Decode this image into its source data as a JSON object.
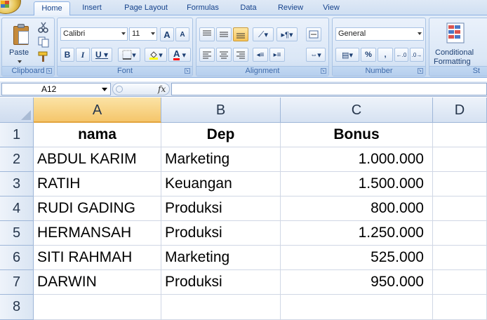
{
  "ribbon": {
    "tabs": [
      "Home",
      "Insert",
      "Page Layout",
      "Formulas",
      "Data",
      "Review",
      "View"
    ],
    "active_tab": "Home",
    "groups": {
      "clipboard": {
        "label": "Clipboard",
        "paste_label": "Paste"
      },
      "font": {
        "label": "Font",
        "font_name": "Calibri",
        "font_size": "11",
        "bold": "B",
        "italic": "I",
        "underline": "U",
        "font_color_glyph": "A",
        "grow_glyph": "A",
        "shrink_glyph": "A"
      },
      "alignment": {
        "label": "Alignment"
      },
      "number": {
        "label": "Number",
        "format": "General",
        "percent": "%",
        "comma": ","
      },
      "styles": {
        "conditional_line1": "Conditional",
        "conditional_line2": "Formatting",
        "partial_label": "St"
      }
    }
  },
  "formula_bar": {
    "name_box": "A12",
    "fx": "fx",
    "content": ""
  },
  "columns": [
    "A",
    "B",
    "C",
    "D"
  ],
  "selected_column": "A",
  "rows": [
    "1",
    "2",
    "3",
    "4",
    "5",
    "6",
    "7",
    "8"
  ],
  "table": {
    "headers": [
      "nama",
      "Dep",
      "Bonus"
    ],
    "records": [
      [
        "ABDUL KARIM",
        "Marketing",
        "1.000.000"
      ],
      [
        "RATIH",
        "Keuangan",
        "1.500.000"
      ],
      [
        "RUDI GADING",
        "Produksi",
        "800.000"
      ],
      [
        "HERMANSAH",
        "Produksi",
        "1.250.000"
      ],
      [
        "SITI RAHMAH",
        "Marketing",
        "525.000"
      ],
      [
        "DARWIN",
        "Produksi",
        "950.000"
      ]
    ]
  }
}
